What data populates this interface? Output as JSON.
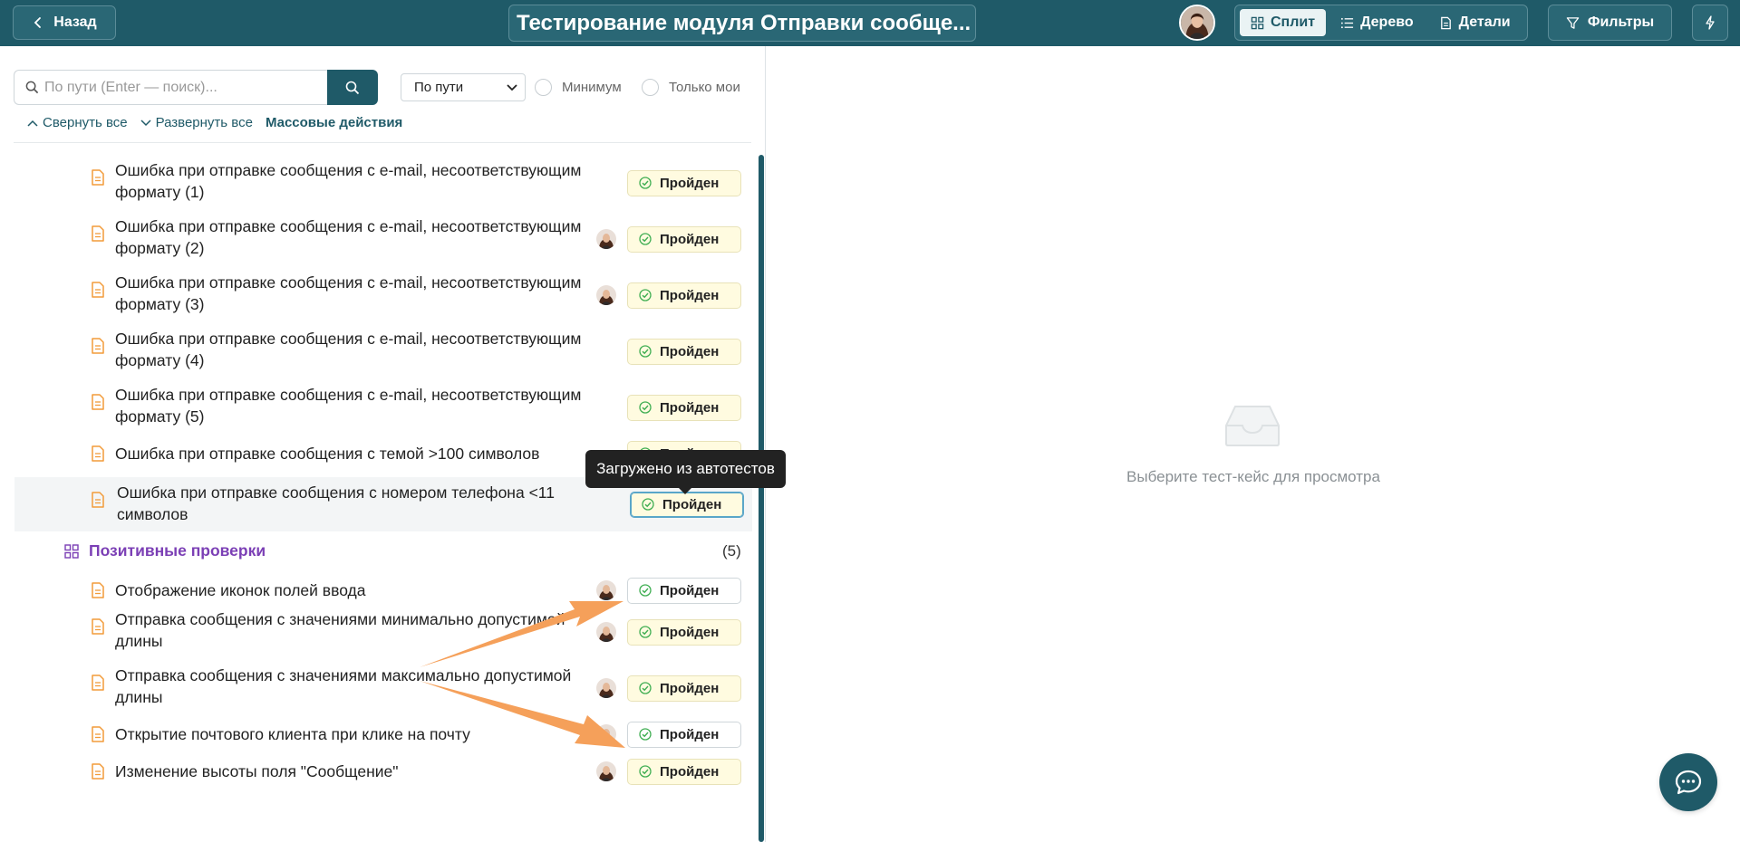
{
  "topbar": {
    "back_label": "Назад",
    "title": "Тестирование модуля Отправки сообще...",
    "views": [
      {
        "label": "Сплит",
        "icon": "split-view-icon",
        "active": true
      },
      {
        "label": "Дерево",
        "icon": "list-icon",
        "active": false
      },
      {
        "label": "Детали",
        "icon": "document-icon",
        "active": false
      }
    ],
    "filters_label": "Фильтры"
  },
  "toolbar": {
    "search_placeholder": "По пути (Enter — поиск)...",
    "sort_value": "По пути",
    "check_minimum": "Минимум",
    "check_only_mine": "Только мои",
    "collapse_all": "Свернуть все",
    "expand_all": "Развернуть все",
    "mass_actions": "Массовые действия"
  },
  "list": {
    "items": [
      {
        "line1": "Ошибка при отправке сообщения с e-mail, несоответствующим",
        "line2": "формату (1)",
        "status": "Пройден",
        "avatar": false
      },
      {
        "line1": "Ошибка при отправке сообщения с e-mail, несоответствующим",
        "line2": "формату (2)",
        "status": "Пройден",
        "avatar": true
      },
      {
        "line1": "Ошибка при отправке сообщения с e-mail, несоответствующим",
        "line2": "формату (3)",
        "status": "Пройден",
        "avatar": true
      },
      {
        "line1": "Ошибка при отправке сообщения с e-mail, несоответствующим",
        "line2": "формату (4)",
        "status": "Пройден",
        "avatar": false
      },
      {
        "line1": "Ошибка при отправке сообщения с e-mail, несоответствующим",
        "line2": "формату (5)",
        "status": "Пройден",
        "avatar": false
      },
      {
        "line1": "Ошибка при отправке сообщения с темой >100 символов",
        "line2": "",
        "status": "Пройден",
        "avatar": false
      },
      {
        "line1": "Ошибка при отправке сообщения с номером телефона <11",
        "line2": "символов",
        "status": "Пройден",
        "avatar": false
      }
    ],
    "group": {
      "label": "Позитивные проверки",
      "count": "(5)"
    },
    "group_items": [
      {
        "line1": "Отображение иконок полей ввода",
        "line2": "",
        "status": "Пройден",
        "avatar": true
      },
      {
        "line1": "Отправка сообщения с значениями минимально допустимой",
        "line2": "длины",
        "status": "Пройден",
        "avatar": true
      },
      {
        "line1": "Отправка сообщения с значениями максимально допустимой",
        "line2": "длины",
        "status": "Пройден",
        "avatar": true
      },
      {
        "line1": "Открытие почтового клиента при клике на почту",
        "line2": "",
        "status": "Пройден",
        "avatar": true
      },
      {
        "line1": "Изменение высоты поля \"Сообщение\"",
        "line2": "",
        "status": "Пройден",
        "avatar": true
      }
    ]
  },
  "tooltip": "Загружено из автотестов",
  "details": {
    "empty_text": "Выберите тест-кейс для просмотра"
  },
  "colors": {
    "brand": "#1f5a68",
    "group_label": "#7b3fb5",
    "doc_icon": "#f29b3a",
    "status_ok": "#3fae52",
    "arrow": "#f5a05a"
  }
}
